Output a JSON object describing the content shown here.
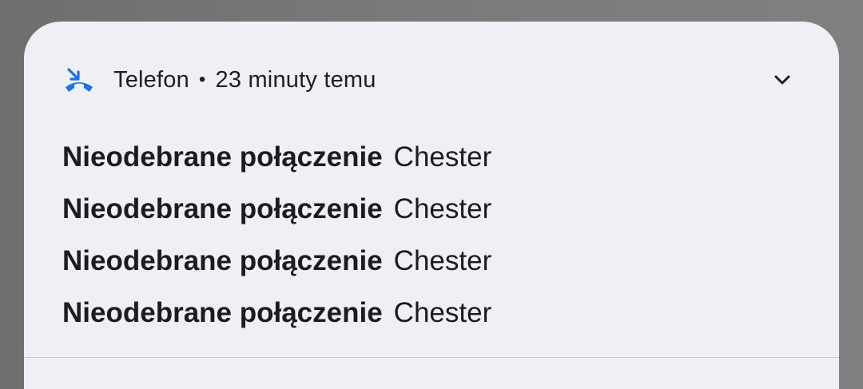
{
  "notification": {
    "app_name": "Telefon",
    "separator": "•",
    "time": "23 minuty temu",
    "icon": "missed-call-icon",
    "expand_icon": "chevron-down-icon",
    "messages": [
      {
        "title": "Nieodebrane połączenie",
        "caller": "Chester"
      },
      {
        "title": "Nieodebrane połączenie",
        "caller": "Chester"
      },
      {
        "title": "Nieodebrane połączenie",
        "caller": "Chester"
      },
      {
        "title": "Nieodebrane połączenie",
        "caller": "Chester"
      }
    ]
  },
  "colors": {
    "accent": "#1a73e8",
    "card_background": "#eff0f5",
    "text": "#1c1c1f"
  }
}
